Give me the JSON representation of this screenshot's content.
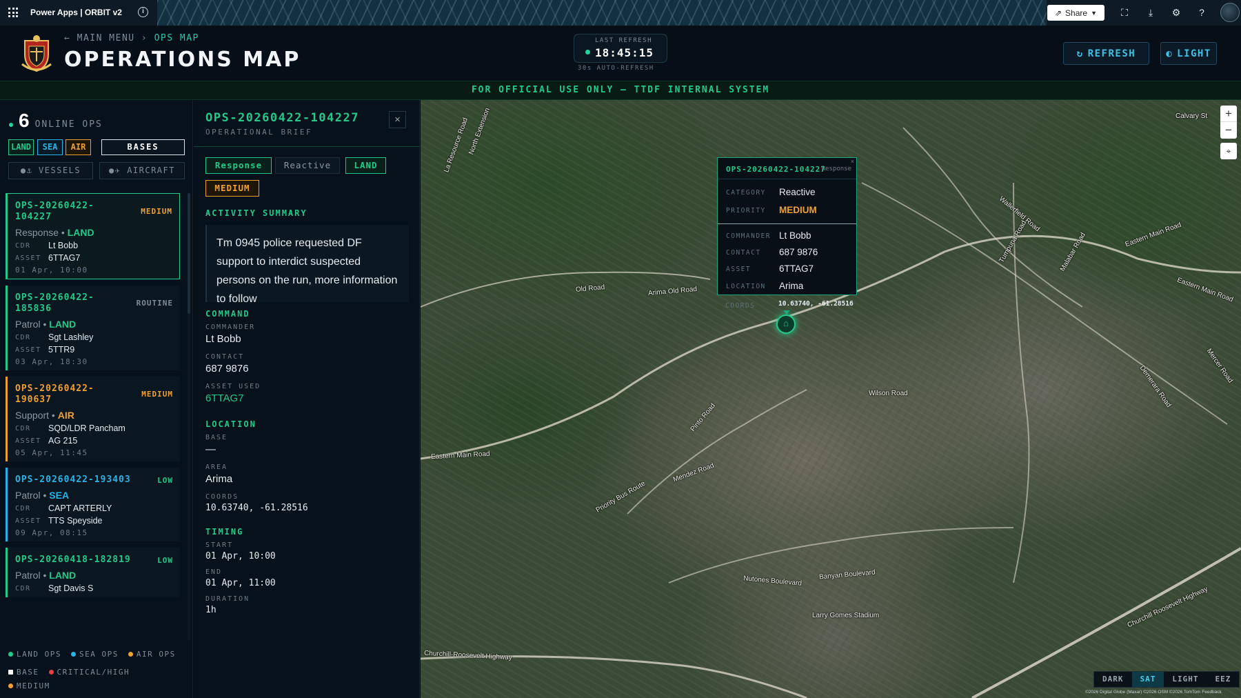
{
  "topbar": {
    "app_title": "Power Apps  |  ORBIT v2",
    "share_label": "Share",
    "icons": [
      "waffle-icon",
      "info-icon",
      "share-icon",
      "fit-screen-icon",
      "download-icon",
      "settings-icon",
      "help-icon",
      "avatar"
    ]
  },
  "header": {
    "back_label": "← MAIN MENU",
    "separator": "›",
    "current": "OPS MAP",
    "title": "OPERATIONS MAP",
    "last_refresh_label": "LAST REFRESH",
    "last_refresh_time": "18:45:15",
    "auto_refresh": "30s AUTO-REFRESH",
    "refresh_button": "REFRESH",
    "theme_button": "LIGHT"
  },
  "banner": "FOR OFFICIAL USE ONLY — TTDF INTERNAL SYSTEM",
  "left": {
    "online_count": "6",
    "online_label": "ONLINE OPS",
    "filters": [
      "LAND",
      "SEA",
      "AIR"
    ],
    "bases_button": "BASES",
    "vessels_button": "VESSELS",
    "aircraft_button": "AIRCRAFT",
    "cards": [
      {
        "id": "OPS-20260422-104227",
        "id_line1": "OPS-20260422-",
        "id_line2": "104227",
        "priority": "MEDIUM",
        "category": "Response",
        "domain": "LAND",
        "cdr": "Lt Bobb",
        "asset": "6TTAG7",
        "datetime": "01 Apr, 10:00"
      },
      {
        "id": "OPS-20260422-185836",
        "id_line1": "OPS-20260422-",
        "id_line2": "185836",
        "priority": "ROUTINE",
        "category": "Patrol",
        "domain": "LAND",
        "cdr": "Sgt Lashley",
        "asset": "5TTR9",
        "datetime": "03 Apr, 18:30"
      },
      {
        "id": "OPS-20260422-190637",
        "id_line1": "OPS-20260422-",
        "id_line2": "190637",
        "priority": "MEDIUM",
        "category": "Support",
        "domain": "AIR",
        "cdr": "SQD/LDR Pancham",
        "asset": "AG 215",
        "datetime": "05 Apr, 11:45"
      },
      {
        "id": "OPS-20260422-193403",
        "id_line1": "OPS-20260422-193403",
        "id_line2": "",
        "priority": "LOW",
        "category": "Patrol",
        "domain": "SEA",
        "cdr": "CAPT ARTERLY",
        "asset": "TTS Speyside",
        "datetime": "09 Apr, 08:15"
      },
      {
        "id": "OPS-20260418-182819",
        "id_line1": "OPS-20260418-182819",
        "id_line2": "",
        "priority": "LOW",
        "category": "Patrol",
        "domain": "LAND",
        "cdr": "Sgt Davis S",
        "asset": "",
        "datetime": ""
      }
    ],
    "cdr_key": "CDR",
    "asset_key": "ASSET",
    "legend": {
      "land": "LAND OPS",
      "sea": "SEA OPS",
      "air": "AIR OPS",
      "base": "BASE",
      "critical": "CRITICAL/HIGH",
      "medium": "MEDIUM"
    }
  },
  "brief": {
    "id": "OPS-20260422-104227",
    "subtitle": "OPERATIONAL BRIEF",
    "close": "×",
    "tags": {
      "category": "Response",
      "type": "Reactive",
      "domain": "LAND",
      "priority": "MEDIUM"
    },
    "activity_heading": "ACTIVITY SUMMARY",
    "activity_text": "Tm 0945 police requested DF support to interdict suspected persons on the run, more information to follow",
    "command_heading": "COMMAND",
    "commander_label": "COMMANDER",
    "commander": "Lt Bobb",
    "contact_label": "CONTACT",
    "contact": "687 9876",
    "asset_label": "ASSET USED",
    "asset": "6TTAG7",
    "location_heading": "LOCATION",
    "base_label": "BASE",
    "base": "—",
    "area_label": "AREA",
    "area": "Arima",
    "coords_label": "COORDS",
    "coords": "10.63740, -61.28516",
    "timing_heading": "TIMING",
    "start_label": "START",
    "start": "01 Apr, 10:00",
    "end_label": "END",
    "end": "01 Apr, 11:00",
    "duration_label": "DURATION",
    "duration": "1h"
  },
  "map": {
    "popup": {
      "id": "OPS-20260422-104227",
      "type": "Response",
      "close": "×",
      "category_label": "CATEGORY",
      "category": "Reactive",
      "priority_label": "PRIORITY",
      "priority": "MEDIUM",
      "commander_label": "COMMANDER",
      "commander": "Lt Bobb",
      "contact_label": "CONTACT",
      "contact": "687 9876",
      "asset_label": "ASSET",
      "asset": "6TTAG7",
      "location_label": "LOCATION",
      "location": "Arima",
      "coords_label": "COORDS",
      "coords": "10.63740, -61.28516"
    },
    "zoom_in": "+",
    "zoom_out": "−",
    "compass": "⌖",
    "layers": [
      "DARK",
      "SAT",
      "LIGHT",
      "EEZ"
    ],
    "active_layer": "SAT",
    "attribution": "©2026 Digital Globe (Maxar) ©2026 OSM ©2026 TomTom Feedback",
    "road_labels": [
      "La Resource Road",
      "North Extension",
      "Old Road",
      "Arima Old Road",
      "Eastern Main Road",
      "Priority Bus Route",
      "Mendez Road",
      "Nutones Boulevard",
      "Banyan Boulevard",
      "Larry Gomes Stadium",
      "Churchill-Roosevelt Highway",
      "Churchill Roosevelt Highway",
      "Pinto Road",
      "Wallerfield Road",
      "Demerara Road",
      "Tumpuna Road",
      "Malabar Road",
      "Wilson Road",
      "Eastern Main Road",
      "Eastern Main Road",
      "Mercer Road",
      "Calvary St"
    ]
  },
  "colors": {
    "land": "#22c98a",
    "sea": "#2ab3e6",
    "air": "#f0a030",
    "medium": "#f0a030",
    "low": "#22c98a",
    "routine": "#7d8d99",
    "critical": "#e84040",
    "base": "#ffffff"
  }
}
